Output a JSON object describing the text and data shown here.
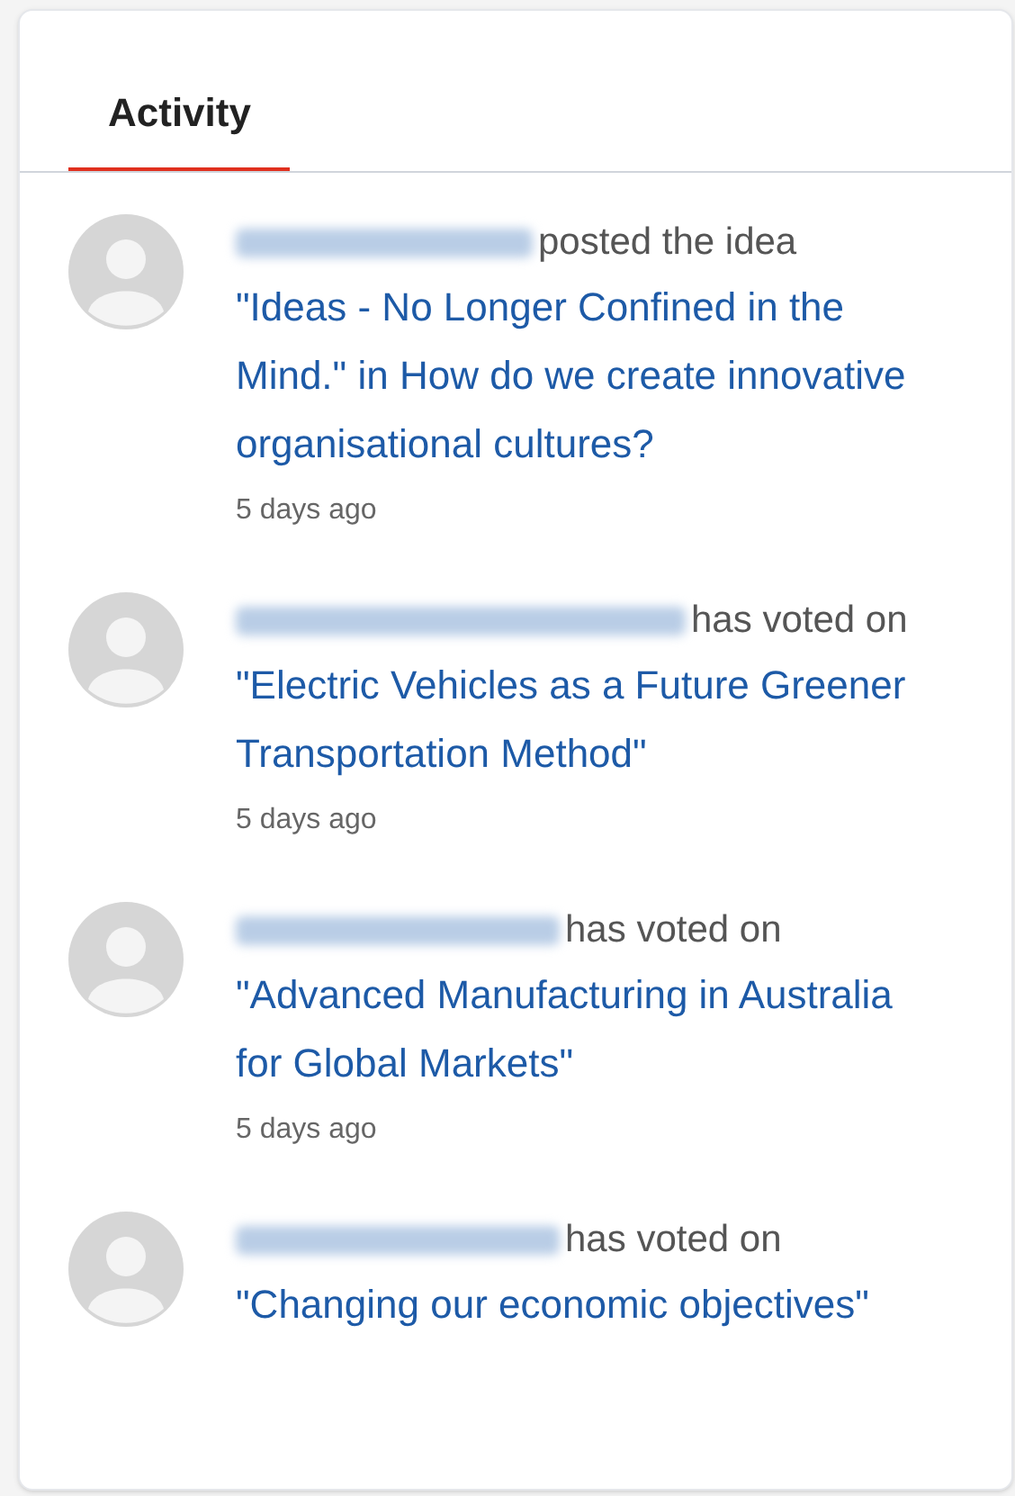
{
  "tabs": [
    {
      "label": "Activity",
      "selected": true
    }
  ],
  "activity": [
    {
      "author": {
        "redacted": true
      },
      "action": "posted the idea",
      "link": "\"Ideas - No Longer Confined in the Mind.\" in How do we create innovative organisational cultures?",
      "time": "5 days ago"
    },
    {
      "author": {
        "redacted": true
      },
      "action": "has voted on",
      "link": "\"Electric Vehicles as a Future Greener Transportation Method\"",
      "time": "5 days ago"
    },
    {
      "author": {
        "redacted": true
      },
      "action": "has voted on",
      "link": "\"Advanced Manufacturing in Australia for Global Markets\"",
      "time": "5 days ago"
    },
    {
      "author": {
        "redacted": true
      },
      "action": "has voted on",
      "link": "\"Changing our economic objectives\""
    }
  ]
}
